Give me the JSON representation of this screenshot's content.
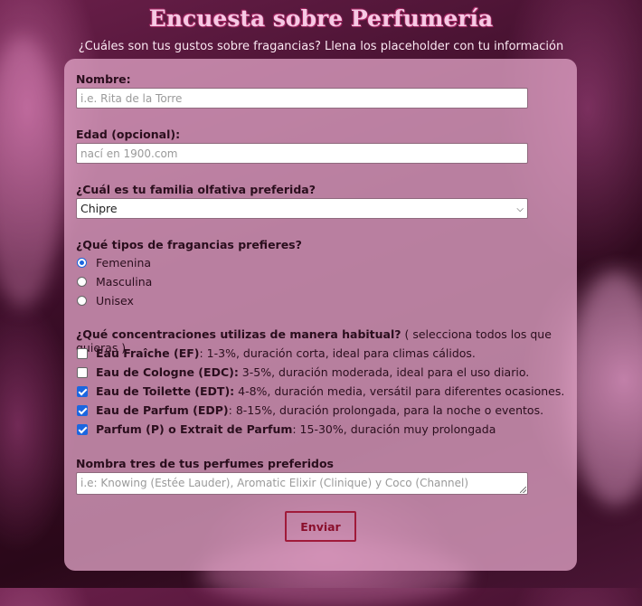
{
  "header": {
    "title": "Encuesta sobre Perfumería",
    "subtitle": "¿Cuáles son tus gustos sobre fragancias? Llena los placeholder con tu información"
  },
  "form": {
    "name_label": "Nombre:",
    "name_placeholder": "i.e. Rita de la Torre",
    "age_label": "Edad (opcional):",
    "age_placeholder": "nací en 1900.com",
    "family_label": "¿Cuál es tu familia olfativa preferida?",
    "family_selected": "Chipre",
    "types_label": "¿Qué tipos de fragancias prefieres?",
    "types": [
      {
        "label": "Femenina",
        "selected": true
      },
      {
        "label": "Masculina",
        "selected": false
      },
      {
        "label": "Unisex",
        "selected": false
      }
    ],
    "conc_label": "¿Qué concentraciones utilizas de manera habitual?",
    "conc_hint": " ( selecciona todos los que quieras )",
    "concentrations": [
      {
        "name": "Eau Fraîche (EF)",
        "desc": ": 1-3%, duración corta, ideal para climas cálidos.",
        "checked": false
      },
      {
        "name": "Eau de Cologne (EDC):",
        "desc": " 3-5%, duración moderada, ideal para el uso diario.",
        "checked": false
      },
      {
        "name": "Eau de Toilette (EDT):",
        "desc": " 4-8%, duración media, versátil para diferentes ocasiones.",
        "checked": true
      },
      {
        "name": "Eau de Parfum (EDP)",
        "desc": ": 8-15%, duración prolongada, para la noche o eventos.",
        "checked": true
      },
      {
        "name": "Parfum (P) o Extrait de Parfum",
        "desc": ": 15-30%, duración muy prolongada",
        "checked": true
      }
    ],
    "fav_label": "Nombra tres de tus perfumes preferidos",
    "fav_placeholder": "i.e: Knowing (Estée Lauder), Aromatic Elixir (Clinique) y Coco (Channel)",
    "submit_label": "Enviar"
  },
  "colors": {
    "accent": "#a01a3a",
    "card": "#dea0c3",
    "checkbox": "#1a66e0"
  }
}
